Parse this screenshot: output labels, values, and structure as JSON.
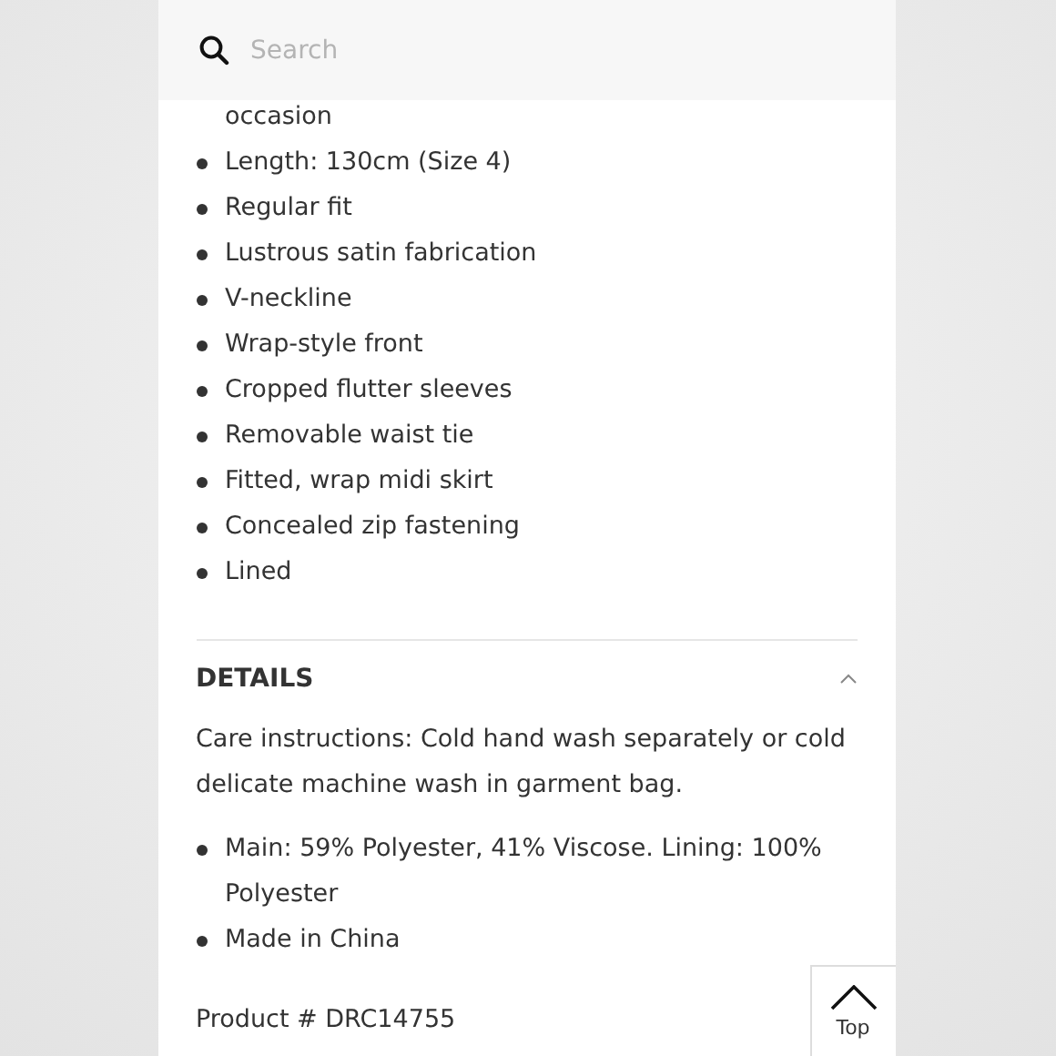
{
  "search": {
    "placeholder": "Search"
  },
  "features": [
    "occasion",
    "Length: 130cm (Size 4)",
    "Regular fit",
    "Lustrous satin fabrication",
    "V-neckline",
    "Wrap-style front",
    "Cropped flutter sleeves",
    "Removable waist tie",
    "Fitted, wrap midi skirt",
    "Concealed zip fastening",
    "Lined"
  ],
  "details": {
    "title": "DETAILS",
    "expanded": true,
    "care": "Care instructions: Cold hand wash separately or cold delicate machine wash in garment bag.",
    "items": [
      "Main: 59% Polyester, 41% Viscose. Lining: 100% Polyester",
      "Made in China"
    ],
    "product": "Product # DRC14755"
  },
  "top_button": {
    "label": "Top"
  }
}
